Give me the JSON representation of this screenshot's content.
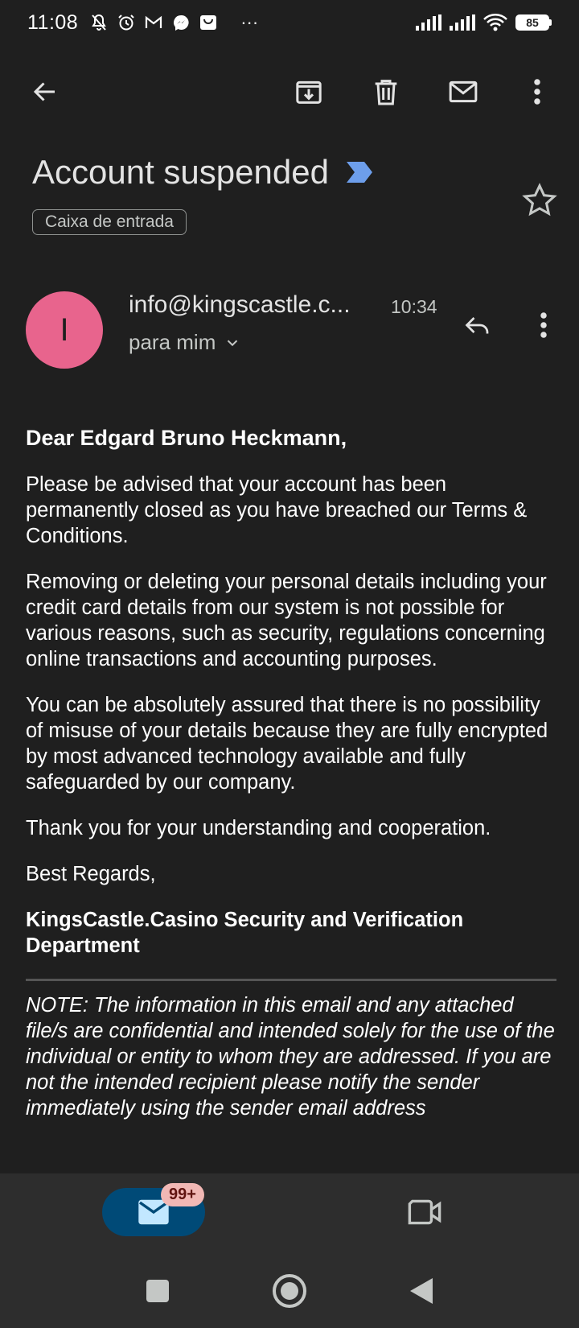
{
  "status_bar": {
    "time": "11:08",
    "more": "···",
    "battery": "85"
  },
  "toolbar": {
    "icons": [
      "back-arrow-icon",
      "archive-icon",
      "delete-icon",
      "mark-unread-icon",
      "more-vert-icon"
    ]
  },
  "email": {
    "subject": "Account suspended",
    "label": "Caixa de entrada",
    "sender": "info@kingscastle.c...",
    "avatar_letter": "I",
    "time": "10:34",
    "recipient": "para mim",
    "greeting": "Dear Edgard Bruno Heckmann,",
    "paragraphs": [
      "Please be advised that your account has been permanently closed as you have breached our Terms & Conditions.",
      "Removing or deleting your personal details including your credit card details from our system is not possible for various reasons, such as security, regulations concerning online transactions and accounting purposes.",
      "You can be absolutely assured that there is no possibility of misuse of your details because they are fully encrypted by most advanced technology available and fully safeguarded by our company.",
      "Thank you for your understanding and cooperation.",
      "Best Regards,"
    ],
    "signature": "KingsCastle.Casino Security and Verification Department",
    "note": "NOTE: The information in this email and any attached file/s are confidential and intended solely for the use of the individual or entity to whom they are addressed. If you are not the intended recipient please notify the sender immediately using the sender email address"
  },
  "bottom_nav": {
    "mail_badge": "99+"
  },
  "colors": {
    "background": "#1f1f1f",
    "avatar": "#e8648d",
    "importance_marker": "#6d9eeb",
    "mail_tab_active": "#004a77",
    "badge_bg": "#f2b8b5",
    "nav_bg": "#2d2d2d"
  }
}
